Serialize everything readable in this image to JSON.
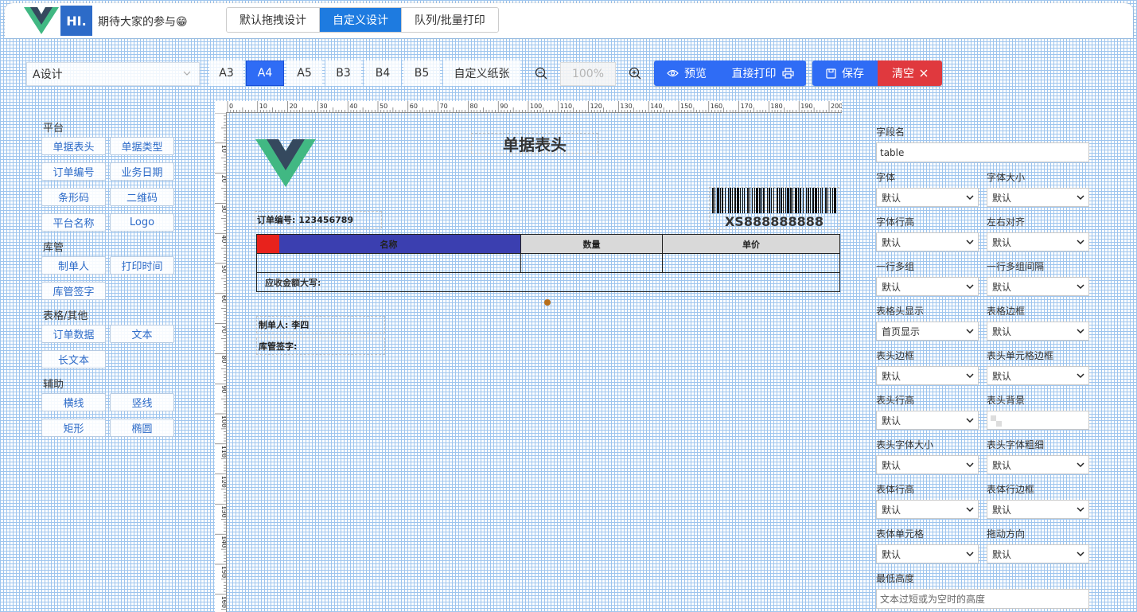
{
  "header": {
    "hi_text": "HI.",
    "slogan": "期待大家的参与😁",
    "tabs": [
      "默认拖拽设计",
      "自定义设计",
      "队列/批量打印"
    ],
    "active_tab": "自定义设计"
  },
  "toolbar": {
    "template_select": "A设计",
    "paper_sizes": [
      "A3",
      "A4",
      "A5",
      "B3",
      "B4",
      "B5",
      "自定义纸张"
    ],
    "active_paper": "A4",
    "zoom": "100%",
    "preview_label": "预览",
    "print_label": "直接打印",
    "save_label": "保存",
    "clear_label": "清空"
  },
  "palette": {
    "sections": [
      {
        "title": "平台",
        "items": [
          "单据表头",
          "单据类型",
          "订单编号",
          "业务日期",
          "条形码",
          "二维码",
          "平台名称",
          "Logo"
        ]
      },
      {
        "title": "库管",
        "items": [
          "制单人",
          "打印时间",
          "库管签字"
        ]
      },
      {
        "title": "表格/其他",
        "items": [
          "订单数据",
          "文本",
          "长文本"
        ]
      },
      {
        "title": "辅助",
        "items": [
          "横线",
          "竖线",
          "矩形",
          "椭圆"
        ]
      }
    ]
  },
  "canvas": {
    "title": "单据表头",
    "order_no": "订单编号: 123456789",
    "barcode_text": "XS888888888",
    "table": {
      "headers": [
        "名称",
        "数量",
        "单价"
      ],
      "footer": "应收金额大写:"
    },
    "maker": "制单人:  李四",
    "sign": "库管签字:"
  },
  "props": {
    "field_name_label": "字段名",
    "field_name_value": "table",
    "fields": [
      {
        "label": "字体",
        "value": "默认"
      },
      {
        "label": "字体大小",
        "value": "默认"
      },
      {
        "label": "字体行高",
        "value": "默认"
      },
      {
        "label": "左右对齐",
        "value": "默认"
      },
      {
        "label": "一行多组",
        "value": "默认"
      },
      {
        "label": "一行多组间隔",
        "value": "默认"
      },
      {
        "label": "表格头显示",
        "value": "首页显示"
      },
      {
        "label": "表格边框",
        "value": "默认"
      },
      {
        "label": "表头边框",
        "value": "默认"
      },
      {
        "label": "表头单元格边框",
        "value": "默认"
      },
      {
        "label": "表头行高",
        "value": "默认"
      },
      {
        "label": "表头背景",
        "value": ""
      },
      {
        "label": "表头字体大小",
        "value": "默认"
      },
      {
        "label": "表头字体粗细",
        "value": "默认"
      },
      {
        "label": "表体行高",
        "value": "默认"
      },
      {
        "label": "表体行边框",
        "value": "默认"
      },
      {
        "label": "表体单元格",
        "value": "默认"
      },
      {
        "label": "拖动方向",
        "value": "默认"
      }
    ],
    "min_height_label": "最低高度",
    "min_height_placeholder": "文本过短或为空时的高度"
  },
  "colors": {
    "primary": "#2f6cf5",
    "danger": "#e0393e",
    "active_tab": "#1e7be0",
    "table_header_first": "#3b3fb0",
    "table_header": "#d9d9d9"
  }
}
